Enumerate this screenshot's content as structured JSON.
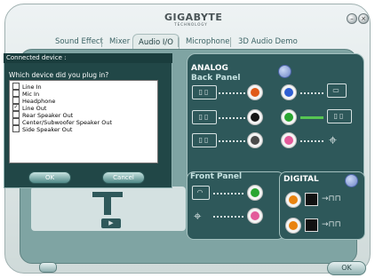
{
  "brand": {
    "name": "GIGABYTE",
    "sub": "TECHNOLOGY"
  },
  "tabs": [
    {
      "label": "Sound Effect"
    },
    {
      "label": "Mixer"
    },
    {
      "label": "Audio I/O",
      "active": true
    },
    {
      "label": "Microphone"
    },
    {
      "label": "3D Audio Demo"
    }
  ],
  "analog": {
    "title": "ANALOG",
    "back_panel": "Back Panel",
    "front_panel": "Front Panel"
  },
  "digital": {
    "title": "DIGITAL"
  },
  "dialog": {
    "title": "Connected device :",
    "question": "Which device did you plug in?",
    "options": [
      {
        "label": "Line In",
        "checked": false
      },
      {
        "label": "Mic In",
        "checked": false
      },
      {
        "label": "Headphone",
        "checked": false
      },
      {
        "label": "Line Out",
        "checked": true
      },
      {
        "label": "Rear Speaker Out",
        "checked": false
      },
      {
        "label": "Center/Subwoofer Speaker Out",
        "checked": false
      },
      {
        "label": "Side Speaker Out",
        "checked": false
      }
    ],
    "ok_label": "OK",
    "cancel_label": "Cancel"
  },
  "footer": {
    "ok_label": "OK"
  },
  "colors": {
    "accent": "#7fa4a3",
    "dark_panel": "#2e585a",
    "orange_jack": "#e05a18",
    "black_jack": "#151515",
    "grey_jack": "#4b4b4b",
    "blue_jack": "#2f5fd2",
    "green_jack": "#2aa531",
    "pink_jack": "#e35a9a"
  },
  "icons": [
    "minimize-icon",
    "close-icon",
    "speaker-icon",
    "headphone-icon",
    "mic-icon",
    "play-icon",
    "info-icon",
    "optical-out-icon",
    "coaxial-out-icon"
  ]
}
